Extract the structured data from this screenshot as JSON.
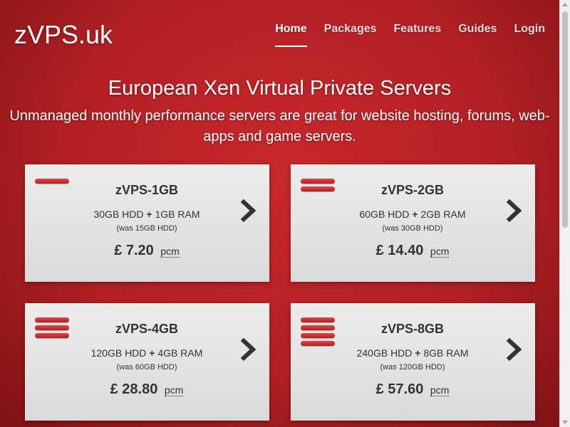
{
  "site": {
    "logo": "zVPS.uk"
  },
  "nav": {
    "items": [
      {
        "label": "Home",
        "active": true
      },
      {
        "label": "Packages",
        "active": false
      },
      {
        "label": "Features",
        "active": false
      },
      {
        "label": "Guides",
        "active": false
      },
      {
        "label": "Login",
        "active": false
      }
    ]
  },
  "hero": {
    "title": "European Xen Virtual Private Servers",
    "subtitle": "Unmanaged monthly performance servers are great for website hosting, forums, web-apps and game servers."
  },
  "plans": [
    {
      "name": "zVPS-1GB",
      "hdd": "30GB HDD",
      "plus": "+",
      "ram": "1GB RAM",
      "was": "(was 15GB HDD)",
      "price": "£ 7.20",
      "period": "pcm",
      "tier_bars": 1
    },
    {
      "name": "zVPS-2GB",
      "hdd": "60GB HDD",
      "plus": "+",
      "ram": "2GB RAM",
      "was": "(was 30GB HDD)",
      "price": "£ 14.40",
      "period": "pcm",
      "tier_bars": 2
    },
    {
      "name": "zVPS-4GB",
      "hdd": "120GB HDD",
      "plus": "+",
      "ram": "4GB RAM",
      "was": "(was 60GB HDD)",
      "price": "£ 28.80",
      "period": "pcm",
      "tier_bars": 3
    },
    {
      "name": "zVPS-8GB",
      "hdd": "240GB HDD",
      "plus": "+",
      "ram": "8GB RAM",
      "was": "(was 120GB HDD)",
      "price": "£ 57.60",
      "period": "pcm",
      "tier_bars": 4
    }
  ],
  "icons": {
    "plan_arrow": "chevron-right-icon",
    "tier_indicator": "tier-bars-icon"
  },
  "colors": {
    "background": "#b22024",
    "card": "#e3e3e3",
    "accent": "#c8282c",
    "text": "#333333"
  }
}
